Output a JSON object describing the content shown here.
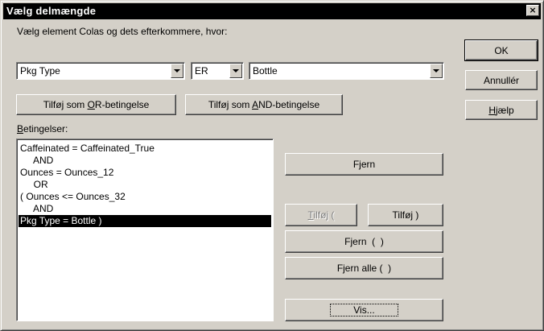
{
  "window": {
    "title": "Vælg delmængde",
    "close_symbol": "×"
  },
  "prompt_label": "Vælg element Colas og dets efterkommere, hvor:",
  "condition_row": {
    "field_select": {
      "value": "Pkg Type"
    },
    "operator_select": {
      "value": "ER"
    },
    "value_select": {
      "value": "Bottle"
    }
  },
  "add_buttons": {
    "or_prefix": "Tilføj som ",
    "or_mnemonic": "O",
    "or_suffix": "R-betingelse",
    "and_prefix": "Tilføj som ",
    "and_mnemonic": "A",
    "and_suffix": "ND-betingelse"
  },
  "conditions_label": {
    "mnemonic": "B",
    "rest": "etingelser:"
  },
  "conditions": [
    {
      "text": "Caffeinated = Caffeinated_True",
      "selected": false
    },
    {
      "text": "     AND",
      "selected": false
    },
    {
      "text": "Ounces = Ounces_12",
      "selected": false
    },
    {
      "text": "     OR",
      "selected": false
    },
    {
      "text": "( Ounces <= Ounces_32",
      "selected": false
    },
    {
      "text": "     AND",
      "selected": false
    },
    {
      "text": "Pkg Type = Bottle )",
      "selected": true
    }
  ],
  "side_buttons": {
    "ok": "OK",
    "cancel": "Annullér",
    "help_mnemonic": "H",
    "help_rest": "jælp"
  },
  "list_buttons": {
    "remove": "Fjern",
    "add_open_mnemonic": "T",
    "add_open_rest": "ilføj (",
    "add_close": "Tilføj )",
    "remove_parens": "Fjern  (  )",
    "remove_all": "Fjern alle (  )",
    "show": "Vis..."
  },
  "icons": {
    "dropdown": "chevron-down-icon",
    "close": "close-icon"
  }
}
